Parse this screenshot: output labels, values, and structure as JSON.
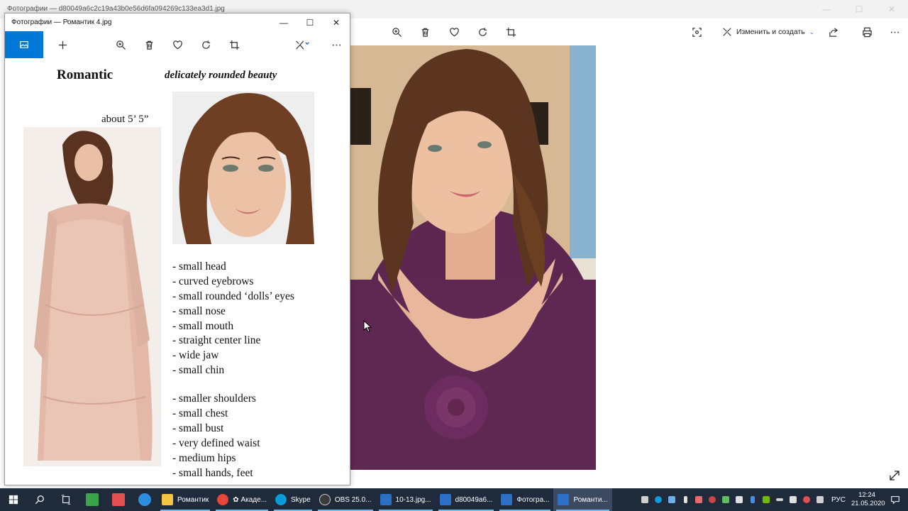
{
  "background_window": {
    "title": "Фотографии — d80049a6c2c19a43b0e56d6fa094269c133ea3d1.jpg",
    "edit_label": "Изменить и создать",
    "toolbar_icons": [
      "zoom-icon",
      "delete-icon",
      "favorite-icon",
      "rotate-icon",
      "crop-icon",
      "enhance-icon",
      "edit-create-icon",
      "share-icon",
      "print-icon",
      "more-icon"
    ]
  },
  "front_window": {
    "title": "Фотографии — Романтик 4.jpg",
    "toolbar_icons": [
      "view-photo-icon",
      "add-icon",
      "zoom-icon",
      "delete-icon",
      "favorite-icon",
      "rotate-icon",
      "crop-icon",
      "edit-icon",
      "more-icon"
    ],
    "document": {
      "title": "Romantic",
      "subtitle": "delicately rounded beauty",
      "height": "about 5’ 5”",
      "features": [
        "- small head",
        "- curved eyebrows",
        "- small rounded ‘dolls’ eyes",
        "- small nose",
        "- small mouth",
        "- straight center line",
        "- wide jaw",
        "- small chin"
      ],
      "body_features": [
        "- smaller shoulders",
        "- small chest",
        "- small bust",
        "- very defined waist",
        "- medium hips",
        "- small hands, feet"
      ]
    }
  },
  "taskbar": {
    "apps": [
      {
        "label": "Романтик",
        "color": "#f4c542"
      },
      {
        "label": "✿ Акаде...",
        "color": "#e8453c"
      },
      {
        "label": "Skype",
        "color": "#0a9ad6"
      },
      {
        "label": "OBS 25.0...",
        "color": "#3a3a3a"
      },
      {
        "label": "10-13.jpg...",
        "color": "#2b6fc7"
      },
      {
        "label": "d80049a6...",
        "color": "#2b6fc7"
      },
      {
        "label": "Фотогра...",
        "color": "#2b6fc7"
      },
      {
        "label": "Романти...",
        "color": "#2b6fc7"
      }
    ],
    "language": "РУС",
    "time": "12:24",
    "date": "21.05.2020"
  },
  "colors": {
    "accent": "#0078d7",
    "taskbar": "#1f2a3a"
  }
}
